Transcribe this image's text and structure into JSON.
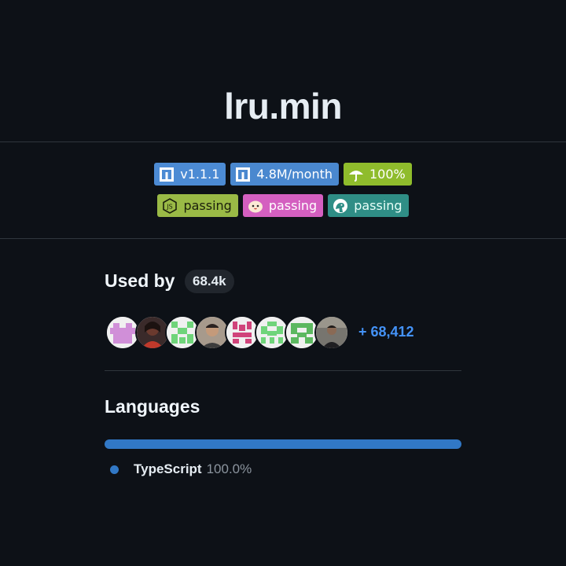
{
  "repo": {
    "title": "lru.min"
  },
  "badges": {
    "row1": [
      {
        "label": "v1.1.1",
        "icon": "npm-icon",
        "color": "#4c8bd4"
      },
      {
        "label": "4.8M/month",
        "icon": "npm-icon",
        "color": "#4a88cf"
      },
      {
        "label": "100%",
        "icon": "coverage-umbrella-icon",
        "color": "#8fbc2c"
      }
    ],
    "row2": [
      {
        "label": "passing",
        "icon": "nodejs-icon",
        "color": "#9aba46"
      },
      {
        "label": "passing",
        "icon": "bun-icon",
        "color": "#d45fc0"
      },
      {
        "label": "passing",
        "icon": "deno-icon",
        "color": "#2f8e86"
      }
    ]
  },
  "used_by": {
    "title": "Used by",
    "count": "68.4k",
    "more": "+ 68,412",
    "avatars": [
      {
        "kind": "identicon",
        "color": "#d08fd8"
      },
      {
        "kind": "photo",
        "color": "#6b3a2e"
      },
      {
        "kind": "identicon",
        "color": "#6fd47a"
      },
      {
        "kind": "photo",
        "color": "#8a7a6a"
      },
      {
        "kind": "identicon",
        "color": "#d0437a"
      },
      {
        "kind": "identicon",
        "color": "#6fd47a"
      },
      {
        "kind": "identicon",
        "color": "#5cb860"
      },
      {
        "kind": "photo",
        "color": "#6c6c6c"
      }
    ]
  },
  "languages": {
    "title": "Languages",
    "items": [
      {
        "name": "TypeScript",
        "percent": "100.0%",
        "color": "#3178c6"
      }
    ]
  }
}
